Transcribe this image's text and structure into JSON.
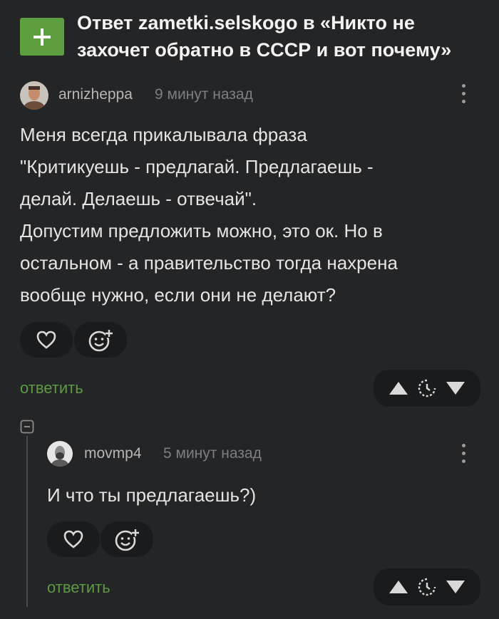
{
  "header": {
    "title_line1": "Ответ zametki.selskogo в «Никто не",
    "title_line2": "захочет обратно в СССР и вот почему»"
  },
  "comment1": {
    "author": "arnizheppa",
    "time": "9 минут назад",
    "lines": [
      "Меня всегда прикалывала фраза",
      "\"Критикуешь - предлагай. Предлагаешь -",
      "делай. Делаешь - отвечай\".",
      "Допустим предложить можно, это ок. Но в",
      "остальном - а правительство тогда нахрена",
      "вообще нужно, если они не делают?"
    ],
    "reply_label": "ответить"
  },
  "comment2": {
    "author": "movmp4",
    "time": "5 минут назад",
    "lines": [
      "И что ты предлагаешь?)"
    ],
    "reply_label": "ответить"
  },
  "icons": [
    "plus-icon",
    "heart-icon",
    "emoji-add-icon",
    "upvote-icon",
    "clock-icon",
    "downvote-icon",
    "more-icon",
    "collapse-icon"
  ],
  "colors": {
    "background": "#242527",
    "accent_green": "#5e9a43",
    "pill_bg": "#1a1b1c"
  }
}
